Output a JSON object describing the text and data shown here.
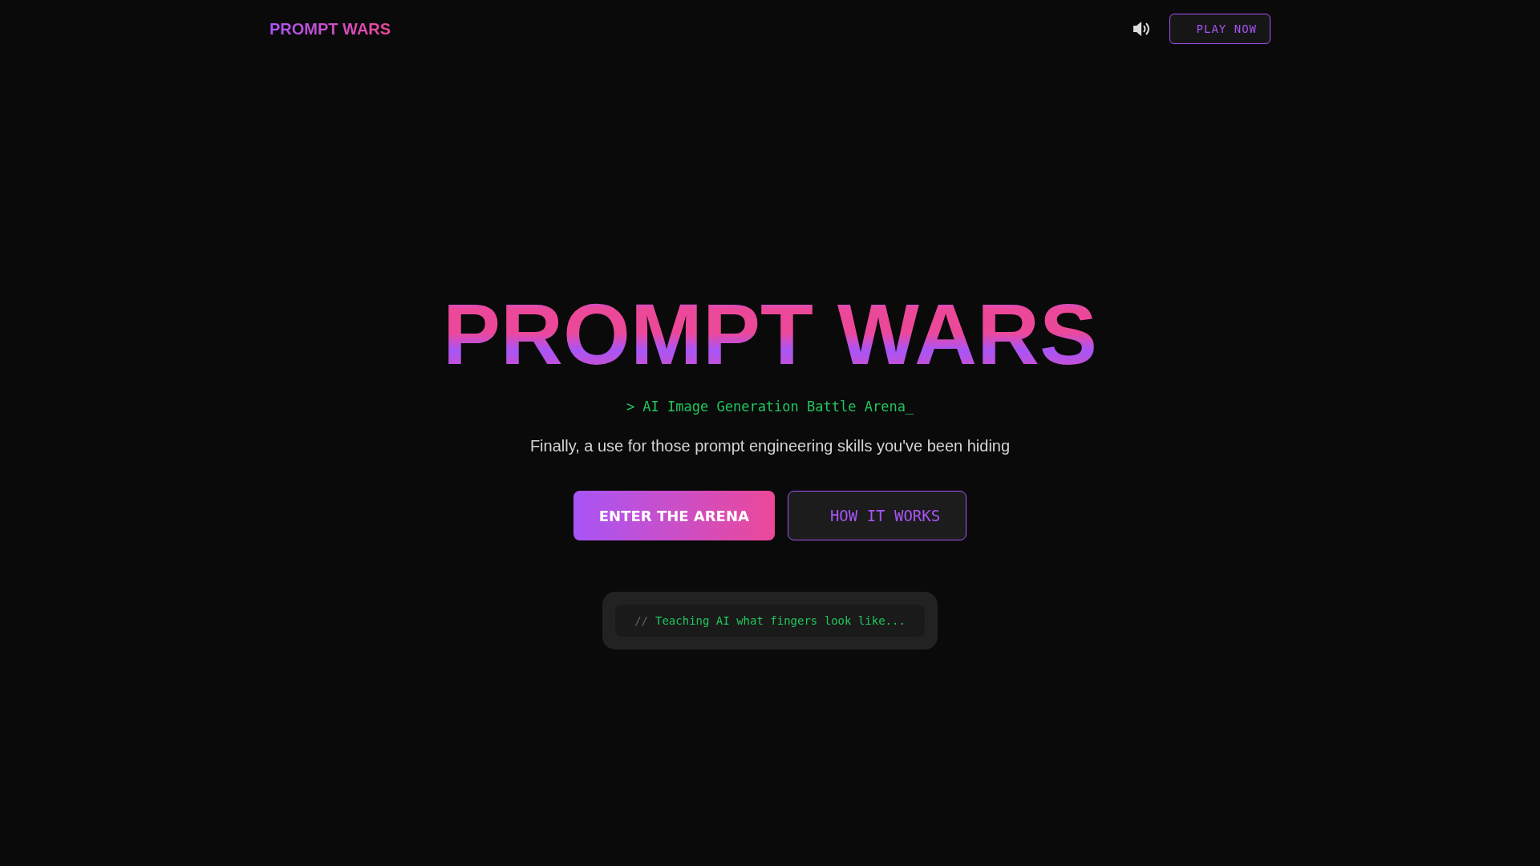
{
  "header": {
    "logo": "PROMPT WARS",
    "sound_on": true,
    "play_button": "PLAY NOW"
  },
  "hero": {
    "title": "PROMPT WARS",
    "subtitle": "> AI Image Generation Battle Arena_",
    "tagline": "Finally, a use for those prompt engineering skills you've been hiding",
    "buttons": [
      {
        "label": "ENTER THE ARENA",
        "kind": "primary"
      },
      {
        "label": "HOW IT WORKS",
        "kind": "outline"
      }
    ],
    "status": {
      "prefix": "//",
      "text": "Teaching AI what fingers look like..."
    }
  }
}
